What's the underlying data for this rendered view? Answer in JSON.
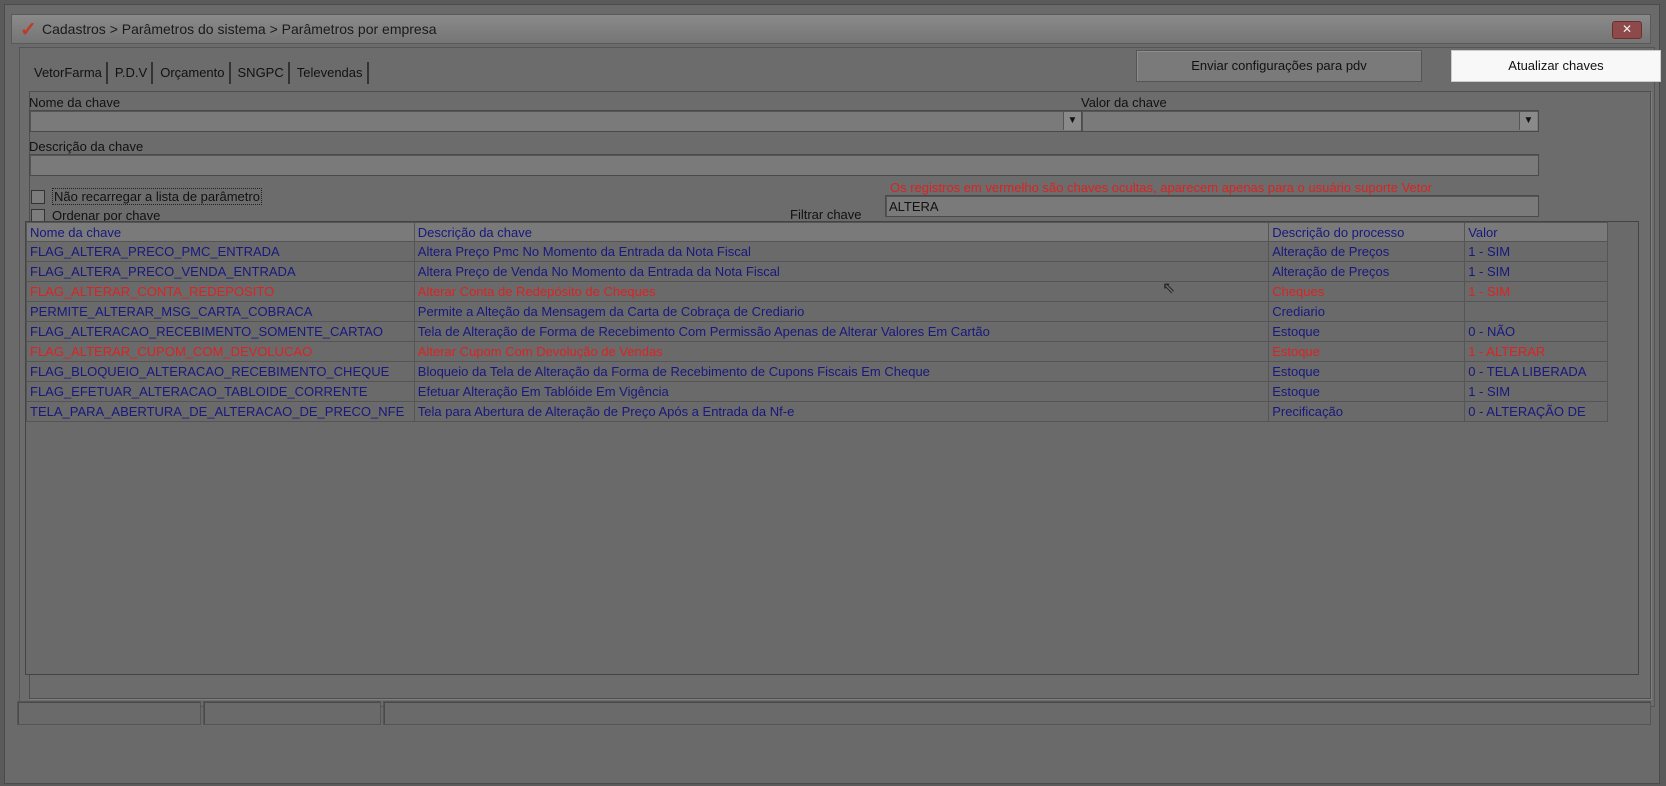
{
  "window": {
    "title": "Cadastros > Parâmetros do sistema > Parâmetros por empresa",
    "close_label": "✕",
    "logo_glyph": "✓"
  },
  "tabs": [
    "VetorFarma",
    "P.D.V",
    "Orçamento",
    "SNGPC",
    "Televendas"
  ],
  "toolbar": {
    "send_label": "Enviar configurações para pdv",
    "update_label": "Atualizar chaves"
  },
  "form": {
    "key_name_label": "Nome da chave",
    "key_name_value": "",
    "key_value_label": "Valor da chave",
    "key_value_value": "",
    "key_desc_label": "Descrição da chave",
    "key_desc_value": "",
    "no_reload_label": "Não recarregar a lista de parâmetro",
    "no_reload_checked": false,
    "order_label": "Ordenar por chave",
    "order_checked": false,
    "notice": "Os registros em vermelho são chaves ocultas, aparecem apenas para o usuário suporte Vetor",
    "filter_label": "Filtrar chave",
    "filter_value": "ALTERA"
  },
  "grid": {
    "columns": [
      "Nome da chave",
      "Descrição  da chave",
      "Descrição do processo",
      "Valor"
    ],
    "rows": [
      {
        "name": "FLAG_ALTERA_PRECO_PMC_ENTRADA",
        "desc": "Altera Preço Pmc No Momento da Entrada da Nota Fiscal",
        "process": "Alteração de Preços",
        "value": "1 - SIM",
        "hidden": false
      },
      {
        "name": "FLAG_ALTERA_PRECO_VENDA_ENTRADA",
        "desc": "Altera Preço de Venda No Momento da Entrada da Nota Fiscal",
        "process": "Alteração de Preços",
        "value": "1 - SIM",
        "hidden": false
      },
      {
        "name": "FLAG_ALTERAR_CONTA_REDEPOSITO",
        "desc": "Alterar Conta de Redepósito de Cheques",
        "process": "Cheques",
        "value": "1 - SIM",
        "hidden": true
      },
      {
        "name": "PERMITE_ALTERAR_MSG_CARTA_COBRACA",
        "desc": "Permite a Alteção da Mensagem da Carta de Cobraça de Crediario",
        "process": "Crediario",
        "value": "",
        "hidden": false
      },
      {
        "name": "FLAG_ALTERACAO_RECEBIMENTO_SOMENTE_CARTAO",
        "desc": "Tela de Alteração de Forma de Recebimento Com Permissão Apenas de Alterar Valores Em Cartão",
        "process": "Estoque",
        "value": "0 - NÃO",
        "hidden": false
      },
      {
        "name": "FLAG_ALTERAR_CUPOM_COM_DEVOLUCAO",
        "desc": "Alterar Cupom Com Devolução de Vendas",
        "process": "Estoque",
        "value": "1 - ALTERAR",
        "hidden": true
      },
      {
        "name": "FLAG_BLOQUEIO_ALTERACAO_RECEBIMENTO_CHEQUE",
        "desc": "Bloqueio da Tela de Alteração da Forma de Recebimento de Cupons Fiscais Em Cheque",
        "process": "Estoque",
        "value": "0 - TELA LIBERADA",
        "hidden": false
      },
      {
        "name": "FLAG_EFETUAR_ALTERACAO_TABLOIDE_CORRENTE",
        "desc": "Efetuar Alteração Em Tablóide Em Vigência",
        "process": "Estoque",
        "value": "1 - SIM",
        "hidden": false
      },
      {
        "name": "TELA_PARA_ABERTURA_DE_ALTERACAO_DE_PRECO_NFE",
        "desc": "Tela para Abertura de Alteração de Preço Após a Entrada da Nf-e",
        "process": "Precificação",
        "value": "0 - ALTERAÇÃO DE",
        "hidden": false
      }
    ]
  },
  "colors": {
    "hidden_key": "#dd2222",
    "normal_key": "#181880"
  }
}
